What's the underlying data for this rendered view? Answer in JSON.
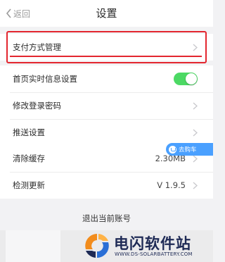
{
  "nav": {
    "back_label": "返回",
    "title": "设置"
  },
  "groups": [
    {
      "rows": [
        {
          "label": "支付方式管理",
          "type": "chevron"
        }
      ]
    },
    {
      "rows": [
        {
          "label": "首页实时信息设置",
          "type": "toggle",
          "on": true
        },
        {
          "label": "修改登录密码",
          "type": "chevron"
        },
        {
          "label": "推送设置",
          "type": "chevron"
        }
      ]
    },
    {
      "rows": [
        {
          "label": "清除缓存",
          "value": "2.30MB",
          "type": "chevron"
        },
        {
          "label": "检测更新",
          "value": "V 1.9.5",
          "type": "chevron"
        }
      ]
    }
  ],
  "floating_pill": {
    "label": "去购车"
  },
  "logout_label": "退出当前账号",
  "watermark": {
    "title": "电闪软件站",
    "url": "WWW.DS-SOLARBATTERY.COM"
  },
  "colors": {
    "toggle_on": "#4cd964",
    "highlight": "#e3262f",
    "pill": "#4aa0ff",
    "chevron": "#c8c8cc"
  }
}
